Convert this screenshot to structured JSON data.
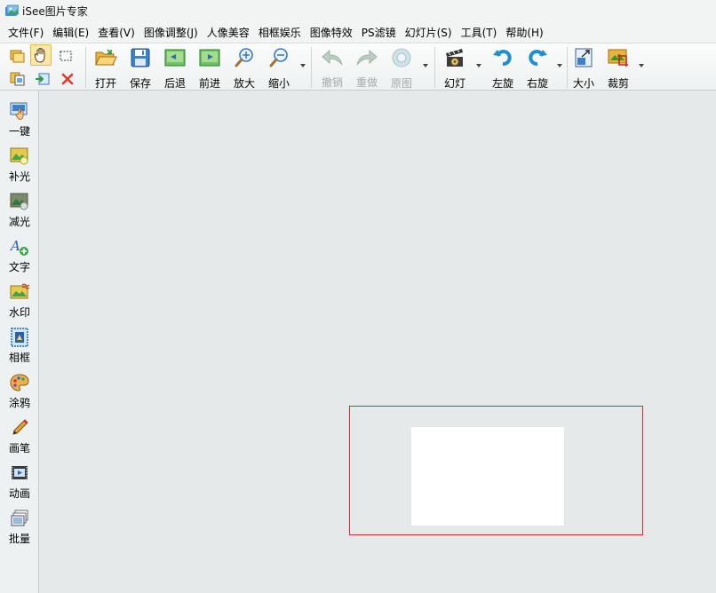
{
  "window": {
    "title": "iSee图片专家"
  },
  "menu": [
    {
      "label": "文件(F)"
    },
    {
      "label": "编辑(E)"
    },
    {
      "label": "查看(V)"
    },
    {
      "label": "图像调整(J)"
    },
    {
      "label": "人像美容"
    },
    {
      "label": "相框娱乐"
    },
    {
      "label": "图像特效"
    },
    {
      "label": "PS滤镜"
    },
    {
      "label": "幻灯片(S)"
    },
    {
      "label": "工具(T)"
    },
    {
      "label": "帮助(H)"
    }
  ],
  "toolbar": {
    "open": "打开",
    "save": "保存",
    "back": "后退",
    "forward": "前进",
    "zoom_in": "放大",
    "zoom_out": "缩小",
    "undo": "撤销",
    "redo": "重做",
    "original": "原图",
    "slideshow": "幻灯",
    "rotate_left": "左旋",
    "rotate_right": "右旋",
    "resize": "大小",
    "crop": "裁剪"
  },
  "sidebar": {
    "items": [
      {
        "label": "一键"
      },
      {
        "label": "补光"
      },
      {
        "label": "减光"
      },
      {
        "label": "文字"
      },
      {
        "label": "水印"
      },
      {
        "label": "相框"
      },
      {
        "label": "涂鸦"
      },
      {
        "label": "画笔"
      },
      {
        "label": "动画"
      },
      {
        "label": "批量"
      }
    ]
  },
  "colors": {
    "accent_red": "#e02a2a",
    "canvas_bg": "#e6e9e9",
    "active_tool": "#fde7a6"
  }
}
